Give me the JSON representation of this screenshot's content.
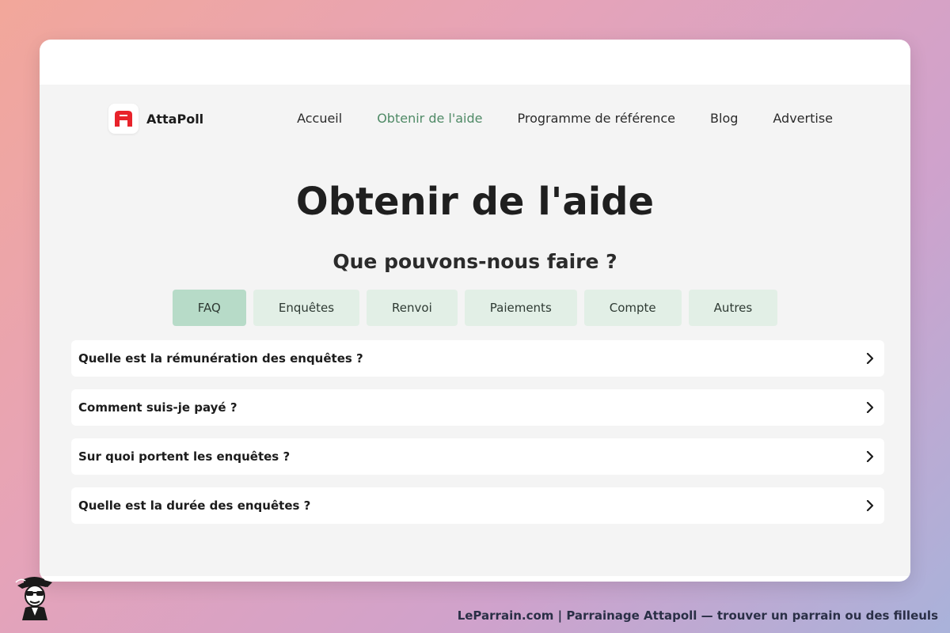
{
  "brand": {
    "name": "AttaPoll",
    "logo_icon": "attapoll-logo-icon",
    "logo_color": "#e8232b"
  },
  "nav": {
    "items": [
      {
        "label": "Accueil",
        "active": false
      },
      {
        "label": "Obtenir de l'aide",
        "active": true
      },
      {
        "label": "Programme de référence",
        "active": false
      },
      {
        "label": "Blog",
        "active": false
      },
      {
        "label": "Advertise",
        "active": false
      }
    ],
    "active_color": "#4f8a66"
  },
  "page": {
    "title": "Obtenir de l'aide",
    "subtitle": "Que pouvons-nous faire ?"
  },
  "tabs": [
    {
      "label": "FAQ",
      "active": true
    },
    {
      "label": "Enquêtes",
      "active": false
    },
    {
      "label": "Renvoi",
      "active": false
    },
    {
      "label": "Paiements",
      "active": false
    },
    {
      "label": "Compte",
      "active": false
    },
    {
      "label": "Autres",
      "active": false
    }
  ],
  "faq": [
    {
      "question": "Quelle est la rémunération des enquêtes ?",
      "icon": "chevron-right-icon"
    },
    {
      "question": "Comment suis-je payé ?",
      "icon": "chevron-right-icon"
    },
    {
      "question": "Sur quoi portent les enquêtes ?",
      "icon": "chevron-right-icon"
    },
    {
      "question": "Quelle est la durée des enquêtes ?",
      "icon": "chevron-right-icon"
    }
  ],
  "footer": {
    "caption": "LeParrain.com | Parrainage Attapoll — trouver un parrain ou des filleuls",
    "mascot_icon": "mascot-icon"
  }
}
